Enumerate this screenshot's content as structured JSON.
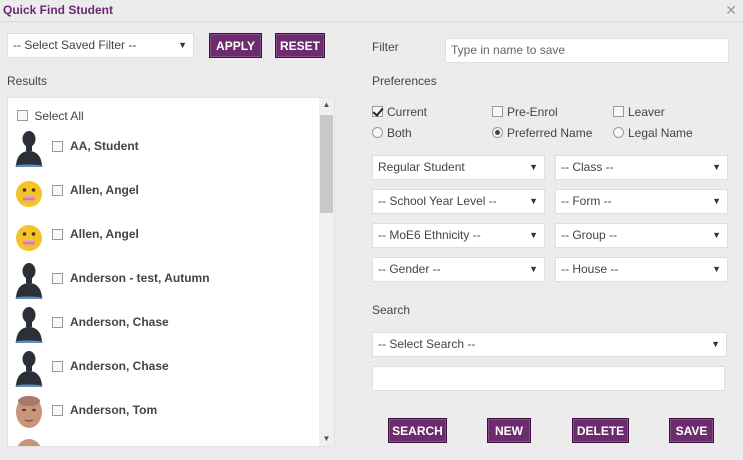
{
  "window": {
    "title": "Quick Find Student"
  },
  "saved_filter": {
    "value": "-- Select Saved Filter --"
  },
  "buttons": {
    "apply": "APPLY",
    "reset": "RESET",
    "search": "SEARCH",
    "new": "NEW",
    "delete": "DELETE",
    "save": "SAVE"
  },
  "filter": {
    "label": "Filter",
    "placeholder": "Type in name to save"
  },
  "results": {
    "label": "Results",
    "select_all": "Select All",
    "items": [
      {
        "name": "AA, Student",
        "avatar": "silhouette"
      },
      {
        "name": "Allen, Angel",
        "avatar": "emoji"
      },
      {
        "name": "Allen, Angel",
        "avatar": "emoji"
      },
      {
        "name": "Anderson - test, Autumn",
        "avatar": "silhouette"
      },
      {
        "name": "Anderson, Chase",
        "avatar": "silhouette"
      },
      {
        "name": "Anderson, Chase",
        "avatar": "silhouette"
      },
      {
        "name": "Anderson, Tom",
        "avatar": "photo"
      }
    ]
  },
  "preferences": {
    "label": "Preferences",
    "current": {
      "label": "Current",
      "checked": true
    },
    "pre_enrol": {
      "label": "Pre-Enrol",
      "checked": false
    },
    "leaver": {
      "label": "Leaver",
      "checked": false
    },
    "both": {
      "label": "Both",
      "selected": false
    },
    "preferred_name": {
      "label": "Preferred Name",
      "selected": true
    },
    "legal_name": {
      "label": "Legal Name",
      "selected": false
    }
  },
  "dropdowns": {
    "student_type": "Regular Student",
    "class": "-- Class --",
    "year_level": "-- School Year Level --",
    "form": "-- Form --",
    "ethnicity": "-- MoE6 Ethnicity --",
    "group": "-- Group --",
    "gender": "-- Gender --",
    "house": "-- House --"
  },
  "search": {
    "label": "Search",
    "select_value": "-- Select Search --",
    "text_value": ""
  },
  "colors": {
    "accent": "#6d2c6e",
    "title": "#6a2a6e",
    "background": "#ececec"
  }
}
